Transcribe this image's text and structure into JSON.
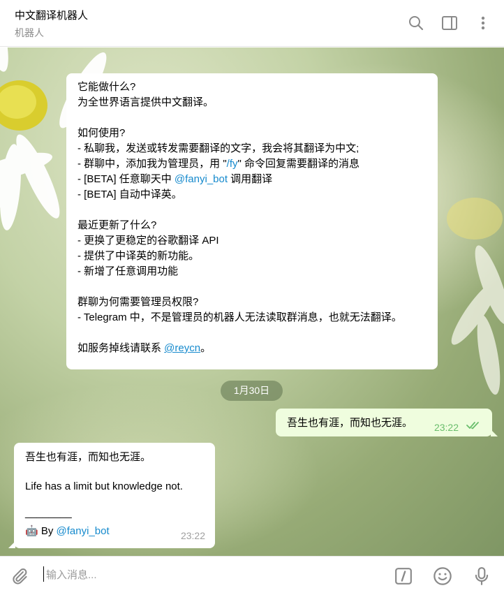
{
  "header": {
    "title": "中文翻译机器人",
    "subtitle": "机器人",
    "icons": [
      "search-icon",
      "sidebar-toggle-icon",
      "more-vertical-icon"
    ]
  },
  "messages": {
    "intro": {
      "lines": [
        "它能做什么?",
        "为全世界语言提供中文翻译。",
        "",
        "如何使用?",
        "- 私聊我，发送或转发需要翻译的文字，我会将其翻译为中文;",
        "- 群聊中，添加我为管理员，用 \"",
        "- [BETA] 任意聊天中 ",
        "- [BETA] 自动中译英。",
        "",
        "最近更新了什么?",
        "- 更换了更稳定的谷歌翻译 API",
        "- 提供了中译英的新功能。",
        "- 新增了任意调用功能",
        "",
        "群聊为何需要管理员权限?",
        "- Telegram 中，不是管理员的机器人无法读取群消息，也就无法翻译。",
        "",
        "如服务掉线请联系 "
      ],
      "cmd_link": "/fy",
      "cmd_suffix": "\" 命令回复需要翻译的消息",
      "bot_link": "@fanyi_bot",
      "bot_suffix": " 调用翻译",
      "contact_link": "@reycn",
      "contact_suffix": "。"
    },
    "date_divider": "1月30日",
    "outgoing": {
      "text": "吾生也有涯，而知也无涯。",
      "time": "23:22",
      "status_icon": "double-check-icon"
    },
    "incoming": {
      "line1": "吾生也有涯，而知也无涯。",
      "line2": "Life has a limit but knowledge not.",
      "separator": "________",
      "by_emoji": "🤖",
      "by_label": " By ",
      "by_link": "@fanyi_bot",
      "time": "23:22"
    }
  },
  "composer": {
    "placeholder": "输入消息...",
    "icons": [
      "attach-icon",
      "bot-command-icon",
      "emoji-icon",
      "microphone-icon"
    ]
  },
  "colors": {
    "link": "#168acd",
    "outgoing_bubble": "#effdde",
    "read_check": "#6abe6c",
    "icon_gray": "#8a8a8a"
  }
}
